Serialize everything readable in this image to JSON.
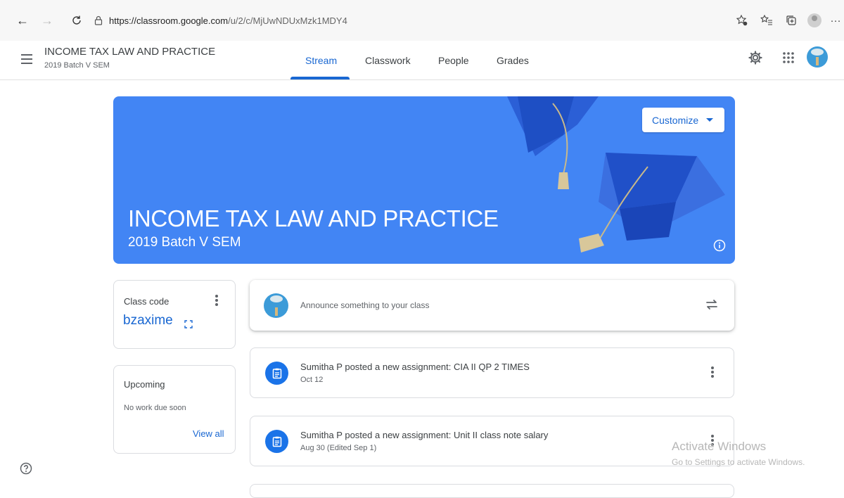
{
  "browser": {
    "url_host": "https://classroom.google.com",
    "url_path": "/u/2/c/MjUwNDUxMzk1MDY4"
  },
  "header": {
    "class_title": "INCOME TAX LAW AND PRACTICE",
    "class_subtitle": "2019 Batch V SEM",
    "tabs": [
      {
        "label": "Stream",
        "active": true
      },
      {
        "label": "Classwork",
        "active": false
      },
      {
        "label": "People",
        "active": false
      },
      {
        "label": "Grades",
        "active": false
      }
    ]
  },
  "banner": {
    "title": "INCOME TAX LAW AND PRACTICE",
    "subtitle": "2019 Batch V SEM",
    "customize_label": "Customize",
    "color": "#4285f4"
  },
  "class_code_card": {
    "label": "Class code",
    "code": "bzaxime"
  },
  "upcoming_card": {
    "label": "Upcoming",
    "empty_text": "No work due soon",
    "view_all": "View all"
  },
  "announce": {
    "placeholder": "Announce something to your class"
  },
  "posts": [
    {
      "title": "Sumitha P posted a new assignment: CIA II QP 2 TIMES",
      "date": "Oct 12"
    },
    {
      "title": "Sumitha P posted a new assignment: Unit II class note salary",
      "date": "Aug 30 (Edited Sep 1)"
    }
  ],
  "watermark": {
    "line1": "Activate Windows",
    "line2": "Go to Settings to activate Windows."
  },
  "colors": {
    "accent": "#1967d2",
    "banner": "#4285f4",
    "assignment_icon": "#1a73e8"
  },
  "icons": [
    "back-icon",
    "forward-icon",
    "refresh-icon",
    "lock-icon",
    "favorite-add-icon",
    "favorites-icon",
    "collections-icon",
    "profile-icon",
    "more-icon",
    "menu-icon",
    "settings-icon",
    "apps-icon",
    "user-avatar",
    "info-icon",
    "fullscreen-icon",
    "repost-icon",
    "assignment-icon",
    "help-icon"
  ]
}
